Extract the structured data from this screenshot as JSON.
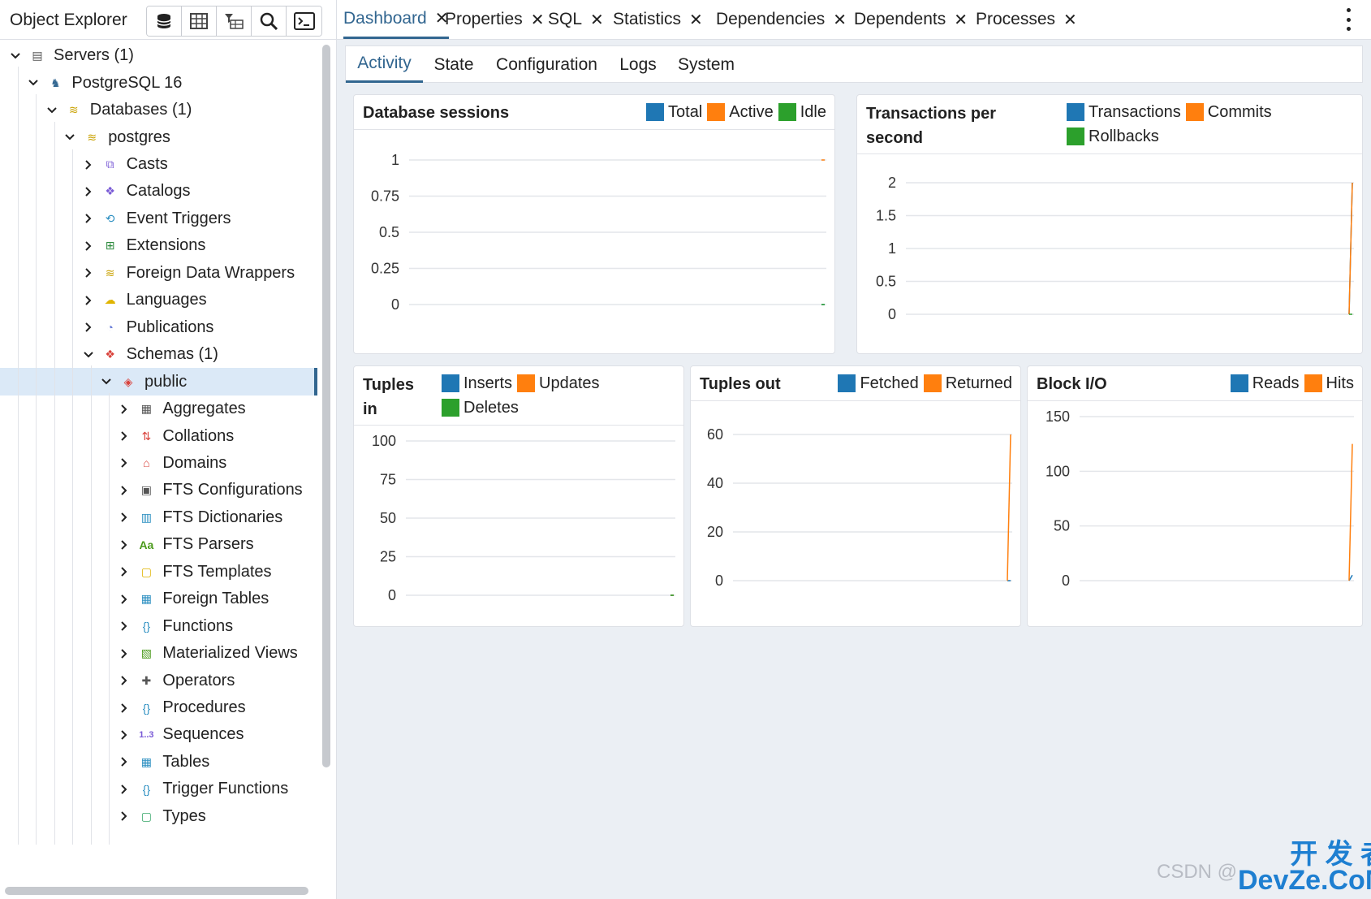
{
  "explorer": {
    "title": "Object Explorer",
    "toolbar": [
      {
        "icon": "database-icon"
      },
      {
        "icon": "table-grid-icon"
      },
      {
        "icon": "filtered-rows-icon"
      },
      {
        "icon": "search-icon"
      },
      {
        "icon": "terminal-icon"
      }
    ],
    "tree": [
      {
        "label": "Servers (1)",
        "level": 0,
        "expanded": true,
        "icon": "servers-icon"
      },
      {
        "label": "PostgreSQL 16",
        "level": 1,
        "expanded": true,
        "icon": "postgres-elephant-icon"
      },
      {
        "label": "Databases (1)",
        "level": 2,
        "expanded": true,
        "icon": "databases-icon"
      },
      {
        "label": "postgres",
        "level": 3,
        "expanded": true,
        "icon": "database-icon"
      },
      {
        "label": "Casts",
        "level": 4,
        "expanded": false,
        "icon": "casts-icon"
      },
      {
        "label": "Catalogs",
        "level": 4,
        "expanded": false,
        "icon": "catalogs-icon"
      },
      {
        "label": "Event Triggers",
        "level": 4,
        "expanded": false,
        "icon": "event-triggers-icon"
      },
      {
        "label": "Extensions",
        "level": 4,
        "expanded": false,
        "icon": "extensions-icon"
      },
      {
        "label": "Foreign Data Wrappers",
        "level": 4,
        "expanded": false,
        "icon": "foreign-data-wrappers-icon"
      },
      {
        "label": "Languages",
        "level": 4,
        "expanded": false,
        "icon": "languages-icon"
      },
      {
        "label": "Publications",
        "level": 4,
        "expanded": false,
        "icon": "publications-icon"
      },
      {
        "label": "Schemas (1)",
        "level": 4,
        "expanded": true,
        "icon": "schemas-icon"
      },
      {
        "label": "public",
        "level": 5,
        "expanded": true,
        "icon": "schema-icon",
        "selected": true
      },
      {
        "label": "Aggregates",
        "level": 6,
        "expanded": false,
        "icon": "aggregates-icon"
      },
      {
        "label": "Collations",
        "level": 6,
        "expanded": false,
        "icon": "collations-icon"
      },
      {
        "label": "Domains",
        "level": 6,
        "expanded": false,
        "icon": "domains-icon"
      },
      {
        "label": "FTS Configurations",
        "level": 6,
        "expanded": false,
        "icon": "fts-configurations-icon"
      },
      {
        "label": "FTS Dictionaries",
        "level": 6,
        "expanded": false,
        "icon": "fts-dictionaries-icon"
      },
      {
        "label": "FTS Parsers",
        "level": 6,
        "expanded": false,
        "icon": "fts-parsers-icon"
      },
      {
        "label": "FTS Templates",
        "level": 6,
        "expanded": false,
        "icon": "fts-templates-icon"
      },
      {
        "label": "Foreign Tables",
        "level": 6,
        "expanded": false,
        "icon": "foreign-tables-icon"
      },
      {
        "label": "Functions",
        "level": 6,
        "expanded": false,
        "icon": "functions-icon"
      },
      {
        "label": "Materialized Views",
        "level": 6,
        "expanded": false,
        "icon": "materialized-views-icon"
      },
      {
        "label": "Operators",
        "level": 6,
        "expanded": false,
        "icon": "operators-icon"
      },
      {
        "label": "Procedures",
        "level": 6,
        "expanded": false,
        "icon": "procedures-icon"
      },
      {
        "label": "Sequences",
        "level": 6,
        "expanded": false,
        "icon": "sequences-icon"
      },
      {
        "label": "Tables",
        "level": 6,
        "expanded": false,
        "icon": "tables-icon"
      },
      {
        "label": "Trigger Functions",
        "level": 6,
        "expanded": false,
        "icon": "trigger-functions-icon"
      },
      {
        "label": "Types",
        "level": 6,
        "expanded": false,
        "icon": "types-icon"
      }
    ]
  },
  "tabs": [
    {
      "label": "Dashboard",
      "active": true
    },
    {
      "label": "Properties",
      "active": false
    },
    {
      "label": "SQL",
      "active": false
    },
    {
      "label": "Statistics",
      "active": false
    },
    {
      "label": "Dependencies",
      "active": false
    },
    {
      "label": "Dependents",
      "active": false
    },
    {
      "label": "Processes",
      "active": false
    }
  ],
  "subtabs": [
    {
      "label": "Activity",
      "active": true
    },
    {
      "label": "State",
      "active": false
    },
    {
      "label": "Configuration",
      "active": false
    },
    {
      "label": "Logs",
      "active": false
    },
    {
      "label": "System",
      "active": false
    }
  ],
  "colors": {
    "accent": "#326690",
    "blue": "#1f77b4",
    "orange": "#ff7f0e",
    "green": "#2ca02c"
  },
  "chart_data": [
    {
      "id": "sessions",
      "type": "line",
      "title": "Database sessions",
      "ylim": [
        0,
        1
      ],
      "yticks": [
        "1",
        "0.75",
        "0.5",
        "0.25",
        "0"
      ],
      "series": [
        {
          "name": "Total",
          "color": "#1f77b4",
          "values": [
            0,
            0
          ]
        },
        {
          "name": "Active",
          "color": "#ff7f0e",
          "values": [
            1,
            1
          ]
        },
        {
          "name": "Idle",
          "color": "#2ca02c",
          "values": [
            0,
            0
          ]
        }
      ]
    },
    {
      "id": "tps",
      "type": "line",
      "title": [
        "Transactions per",
        "second"
      ],
      "ylim": [
        0,
        2
      ],
      "yticks": [
        "2",
        "1.5",
        "1",
        "0.5",
        "0"
      ],
      "series": [
        {
          "name": "Transactions",
          "color": "#1f77b4",
          "values": [
            0,
            2
          ]
        },
        {
          "name": "Commits",
          "color": "#ff7f0e",
          "values": [
            0,
            2
          ]
        },
        {
          "name": "Rollbacks",
          "color": "#2ca02c",
          "values": [
            0,
            0
          ]
        }
      ]
    },
    {
      "id": "tuples_in",
      "type": "line",
      "title": [
        "Tuples",
        "in"
      ],
      "ylim": [
        0,
        100
      ],
      "yticks": [
        "100",
        "75",
        "50",
        "25",
        "0"
      ],
      "series": [
        {
          "name": "Inserts",
          "color": "#1f77b4",
          "values": [
            0,
            0
          ]
        },
        {
          "name": "Updates",
          "color": "#ff7f0e",
          "values": [
            0,
            0
          ]
        },
        {
          "name": "Deletes",
          "color": "#2ca02c",
          "values": [
            0,
            0
          ]
        }
      ]
    },
    {
      "id": "tuples_out",
      "type": "line",
      "title": "Tuples out",
      "ylim": [
        0,
        60
      ],
      "yticks": [
        "60",
        "40",
        "20",
        "0"
      ],
      "series": [
        {
          "name": "Fetched",
          "color": "#1f77b4",
          "values": [
            0,
            0
          ]
        },
        {
          "name": "Returned",
          "color": "#ff7f0e",
          "values": [
            0,
            60
          ]
        }
      ]
    },
    {
      "id": "block_io",
      "type": "line",
      "title": "Block I/O",
      "ylim": [
        0,
        150
      ],
      "yticks": [
        "150",
        "100",
        "50",
        "0"
      ],
      "series": [
        {
          "name": "Reads",
          "color": "#1f77b4",
          "values": [
            0,
            5
          ]
        },
        {
          "name": "Hits",
          "color": "#ff7f0e",
          "values": [
            0,
            125
          ]
        }
      ]
    }
  ],
  "watermark": {
    "left": "CSDN @",
    "right_top": "开 发 者",
    "right_bottom": "DevZe.CoM"
  }
}
